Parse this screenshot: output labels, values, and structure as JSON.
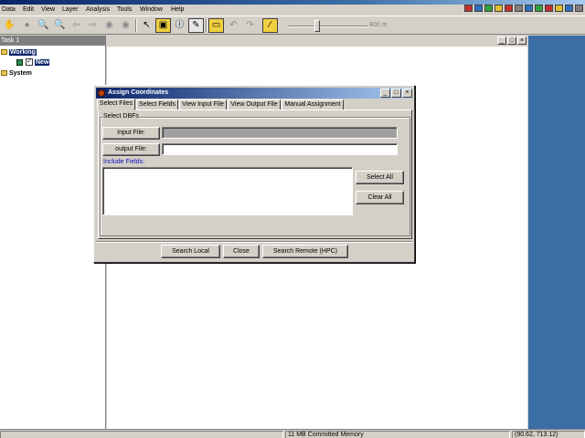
{
  "app": {
    "title": ""
  },
  "menu": [
    "Data",
    "Edit",
    "View",
    "Layer",
    "Analysis",
    "Tools",
    "Window",
    "Help"
  ],
  "toolbar": {
    "icons": [
      "hand-icon",
      "circle-icon",
      "zoom-in-icon",
      "zoom-out-icon",
      "back-arrow-icon",
      "forward-arrow-icon",
      "globe-icon",
      "globe-2-icon",
      "pointer-icon",
      "cube-icon",
      "info-icon",
      "edit-icon",
      "ruler-icon",
      "undo-icon",
      "redo-icon",
      "pencil-icon"
    ],
    "slider_readout": "400 m",
    "slider_level": 0.36
  },
  "layer_panel": {
    "title": "Task 1",
    "tree": [
      {
        "label": "Working",
        "selected": true
      },
      {
        "label": "New",
        "selected": true,
        "checked": true
      },
      {
        "label": "System",
        "selected": false
      }
    ]
  },
  "dialog": {
    "title": "Assign Coordinates",
    "tabs": [
      "Select Files",
      "Select Fields",
      "View Input File",
      "View Output File",
      "Manual Assignment"
    ],
    "active_tab": "Select Files",
    "group_label": "Select DBFs",
    "input_file_label": "Input File:",
    "input_file_value": "",
    "output_file_label": "output File:",
    "output_file_value": "",
    "include_fields_label": "Include Fields:",
    "select_all_label": "Select All",
    "clear_all_label": "Clear All",
    "search_local_label": "Search Local",
    "close_label": "Close",
    "search_remote_label": "Search Remote (HPC)",
    "window_controls": {
      "minimize": "_",
      "maximize": "□",
      "close": "×"
    }
  },
  "status": {
    "memory": "11 MB Committed Memory",
    "coords": "(90.62, 713.12)"
  },
  "colors": {
    "title_gradient_start": "#0a246a",
    "desktop": "#3a6ea5",
    "window_face": "#d4d0c8"
  }
}
